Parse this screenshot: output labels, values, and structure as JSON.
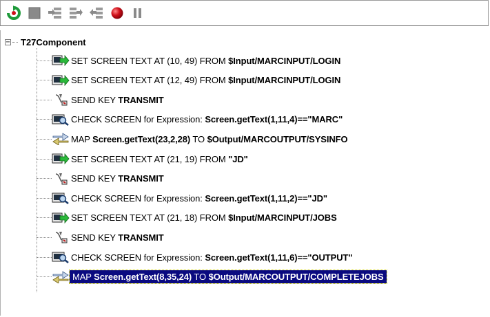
{
  "toolbar": {
    "buttons": [
      "run-icon",
      "stop-icon",
      "step-into-icon",
      "step-over-icon",
      "step-out-icon",
      "record-icon",
      "pause-icon"
    ]
  },
  "tree": {
    "root_label": "T27Component",
    "items": [
      {
        "icon": "set-screen-text-icon",
        "prefix": "SET SCREEN TEXT AT (10, 49) FROM ",
        "bold": "$Input/MARCINPUT/LOGIN",
        "suffix": ""
      },
      {
        "icon": "set-screen-text-icon",
        "prefix": "SET SCREEN TEXT AT (12, 49) FROM ",
        "bold": "$Input/MARCINPUT/LOGIN",
        "suffix": ""
      },
      {
        "icon": "send-key-icon",
        "prefix": "SEND KEY ",
        "bold": "TRANSMIT",
        "suffix": ""
      },
      {
        "icon": "check-screen-icon",
        "prefix": "CHECK SCREEN for Expression: ",
        "bold": "Screen.getText(1,11,4)==\"MARC\"",
        "suffix": ""
      },
      {
        "icon": "map-icon",
        "prefix": "MAP ",
        "bold": "Screen.getText(23,2,28)",
        "suffix": " TO ",
        "bold2": "$Output/MARCOUTPUT/SYSINFO"
      },
      {
        "icon": "set-screen-text-icon",
        "prefix": "SET SCREEN TEXT AT (21, 19) FROM ",
        "bold": "\"JD\"",
        "suffix": ""
      },
      {
        "icon": "send-key-icon",
        "prefix": "SEND KEY ",
        "bold": "TRANSMIT",
        "suffix": ""
      },
      {
        "icon": "check-screen-icon",
        "prefix": "CHECK SCREEN for Expression: ",
        "bold": "Screen.getText(1,11,2)==\"JD\"",
        "suffix": ""
      },
      {
        "icon": "set-screen-text-icon",
        "prefix": "SET SCREEN TEXT AT (21, 18) FROM ",
        "bold": "$Input/MARCINPUT/JOBS",
        "suffix": ""
      },
      {
        "icon": "send-key-icon",
        "prefix": "SEND KEY ",
        "bold": "TRANSMIT",
        "suffix": ""
      },
      {
        "icon": "check-screen-icon",
        "prefix": "CHECK SCREEN for Expression: ",
        "bold": "Screen.getText(1,11,6)==\"OUTPUT\"",
        "suffix": ""
      },
      {
        "icon": "map-icon",
        "prefix": "MAP ",
        "bold": "Screen.getText(8,35,24)",
        "suffix": " TO ",
        "bold2": "$Output/MARCOUTPUT/COMPLETEJOBS",
        "selected": true
      }
    ]
  },
  "colors": {
    "selection_bg": "#0a0a80",
    "run": "#1e9a3a",
    "record": "#d0101a"
  }
}
